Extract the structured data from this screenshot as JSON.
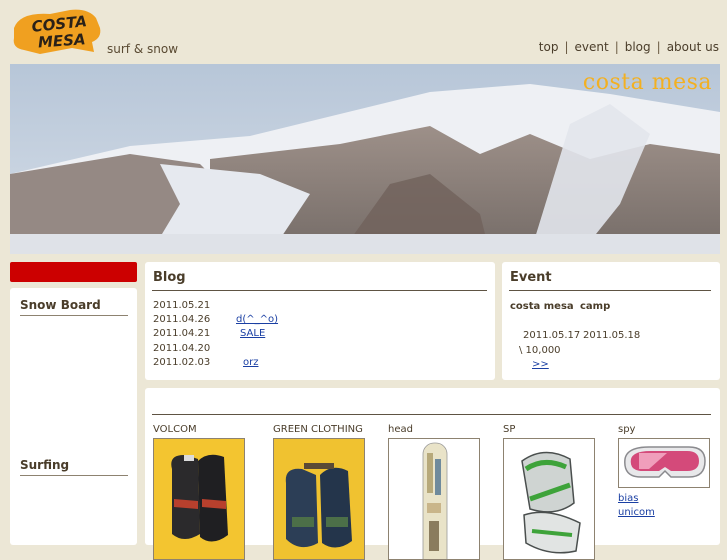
{
  "header": {
    "logo_text_1": "COSTA",
    "logo_text_2": "MESA",
    "tagline": "surf & snow",
    "nav": [
      "top",
      "event",
      "blog",
      "about us"
    ]
  },
  "hero": {
    "brand": "costa mesa"
  },
  "sidebar": {
    "sections": [
      "Snow Board",
      "Surfing"
    ]
  },
  "blog": {
    "title": "Blog",
    "entries": [
      {
        "date": "2011.05.21",
        "text": ""
      },
      {
        "date": "2011.04.26",
        "text": "d(^_^o)"
      },
      {
        "date": "2011.04.21",
        "text": "SALE"
      },
      {
        "date": "2011.04.20",
        "text": ""
      },
      {
        "date": "2011.02.03",
        "text": "orz"
      }
    ]
  },
  "event": {
    "title": "Event",
    "name": "costa mesa",
    "type": "camp",
    "start": "2011.05.17",
    "end": "2011.05.18",
    "price": "\\ 10,000",
    "more": ">>"
  },
  "products": {
    "items": [
      {
        "brand": "VOLCOM",
        "icon": "gloves-image"
      },
      {
        "brand": "GREEN CLOTHING",
        "icon": "mittens-image"
      },
      {
        "brand": "head",
        "icon": "snowboard-image"
      },
      {
        "brand": "SP",
        "icon": "binding-image"
      },
      {
        "brand": "spy",
        "icon": "goggles-image",
        "links": [
          "bias",
          "unicom"
        ]
      }
    ]
  },
  "colors": {
    "background": "#ece7d6",
    "accent_red": "#cc0000",
    "logo_orange": "#f0a020",
    "link_blue": "#1a3fa3"
  }
}
